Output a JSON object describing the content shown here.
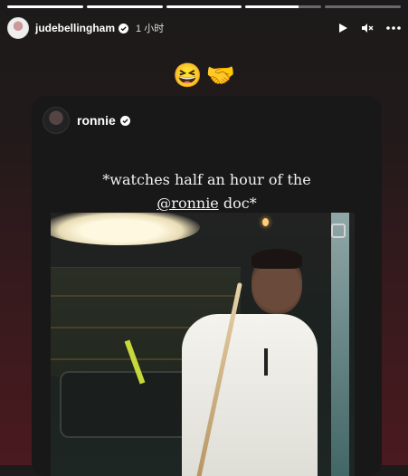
{
  "story": {
    "progress": [
      1.0,
      1.0,
      1.0,
      0.7,
      0.0
    ]
  },
  "header": {
    "username": "judebellingham",
    "time": "1 小时",
    "icons": [
      "play-icon",
      "mute-icon",
      "more-icon"
    ]
  },
  "sticker": {
    "emojis": [
      "😆",
      "🤝"
    ]
  },
  "card": {
    "username": "ronnie",
    "caption_line1": "*watches half an hour of the",
    "caption_mention": "@ronnie",
    "caption_suffix": " doc*"
  },
  "colors": {
    "accent": "#ffffff",
    "background_top": "#1c1a1a",
    "background_bottom": "#4a1a1f"
  }
}
